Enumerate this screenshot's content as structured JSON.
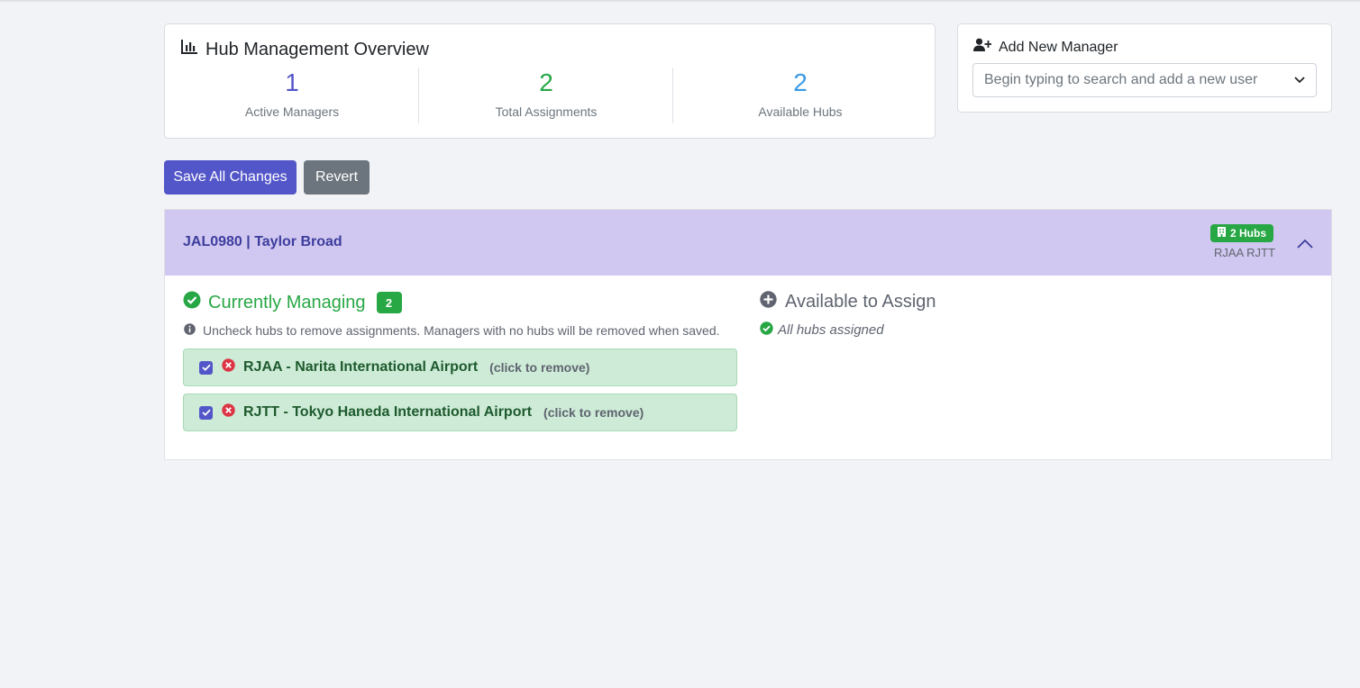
{
  "overview": {
    "title": "Hub Management Overview",
    "stats": [
      {
        "value": "1",
        "label": "Active Managers"
      },
      {
        "value": "2",
        "label": "Total Assignments"
      },
      {
        "value": "2",
        "label": "Available Hubs"
      }
    ]
  },
  "add_manager": {
    "title": "Add New Manager",
    "placeholder": "Begin typing to search and add a new user"
  },
  "actions": {
    "save_label": "Save All Changes",
    "revert_label": "Revert"
  },
  "manager": {
    "name": "JAL0980 | Taylor Broad",
    "hub_badge": "2 Hubs",
    "hub_codes": "RJAA RJTT",
    "currently_managing_title": "Currently Managing",
    "count": "2",
    "note": "Uncheck hubs to remove assignments. Managers with no hubs will be removed when saved.",
    "hubs": [
      {
        "name": "RJAA - Narita International Airport",
        "hint": "(click to remove)"
      },
      {
        "name": "RJTT - Tokyo Haneda International Airport",
        "hint": "(click to remove)"
      }
    ],
    "available_title": "Available to Assign",
    "available_note": "All hubs assigned"
  },
  "colors": {
    "primary": "#5356c8",
    "success": "#28a745",
    "info": "#3a99e4",
    "secondary": "#6c757d",
    "header_bg": "#d0c8f0"
  },
  "icons": [
    "bar-chart-icon",
    "user-plus-icon",
    "chevron-down-icon",
    "building-icon",
    "chevron-up-icon",
    "check-circle-icon",
    "info-icon",
    "checkbox-icon",
    "remove-circle-icon",
    "plus-circle-icon"
  ]
}
